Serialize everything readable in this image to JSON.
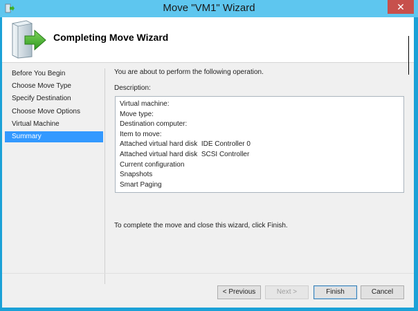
{
  "window": {
    "title": "Move \"VM1\" Wizard",
    "close_glyph": "✕"
  },
  "header": {
    "title": "Completing Move Wizard",
    "icon": "server-arrow-icon"
  },
  "nav": {
    "items": [
      {
        "label": "Before You Begin",
        "active": false
      },
      {
        "label": "Choose Move Type",
        "active": false
      },
      {
        "label": "Specify Destination",
        "active": false
      },
      {
        "label": "Choose Move Options",
        "active": false
      },
      {
        "label": "Virtual Machine",
        "active": false
      },
      {
        "label": "Summary",
        "active": true
      }
    ]
  },
  "main": {
    "intro": "You are about to perform the following operation.",
    "description_label": "Description:",
    "description_lines": [
      "Virtual machine:",
      "Move type:",
      "Destination computer:",
      "Item to move:",
      "Attached virtual hard disk  IDE Controller 0",
      "Attached virtual hard disk  SCSI Controller",
      "Current configuration",
      "Snapshots",
      "Smart Paging"
    ],
    "finish_note": "To complete the move and close this wizard, click Finish."
  },
  "buttons": {
    "previous": "< Previous",
    "next": "Next >",
    "finish": "Finish",
    "cancel": "Cancel"
  },
  "colors": {
    "accent": "#3399ff",
    "titlebar": "#5ec6ef",
    "close": "#c7504c"
  }
}
